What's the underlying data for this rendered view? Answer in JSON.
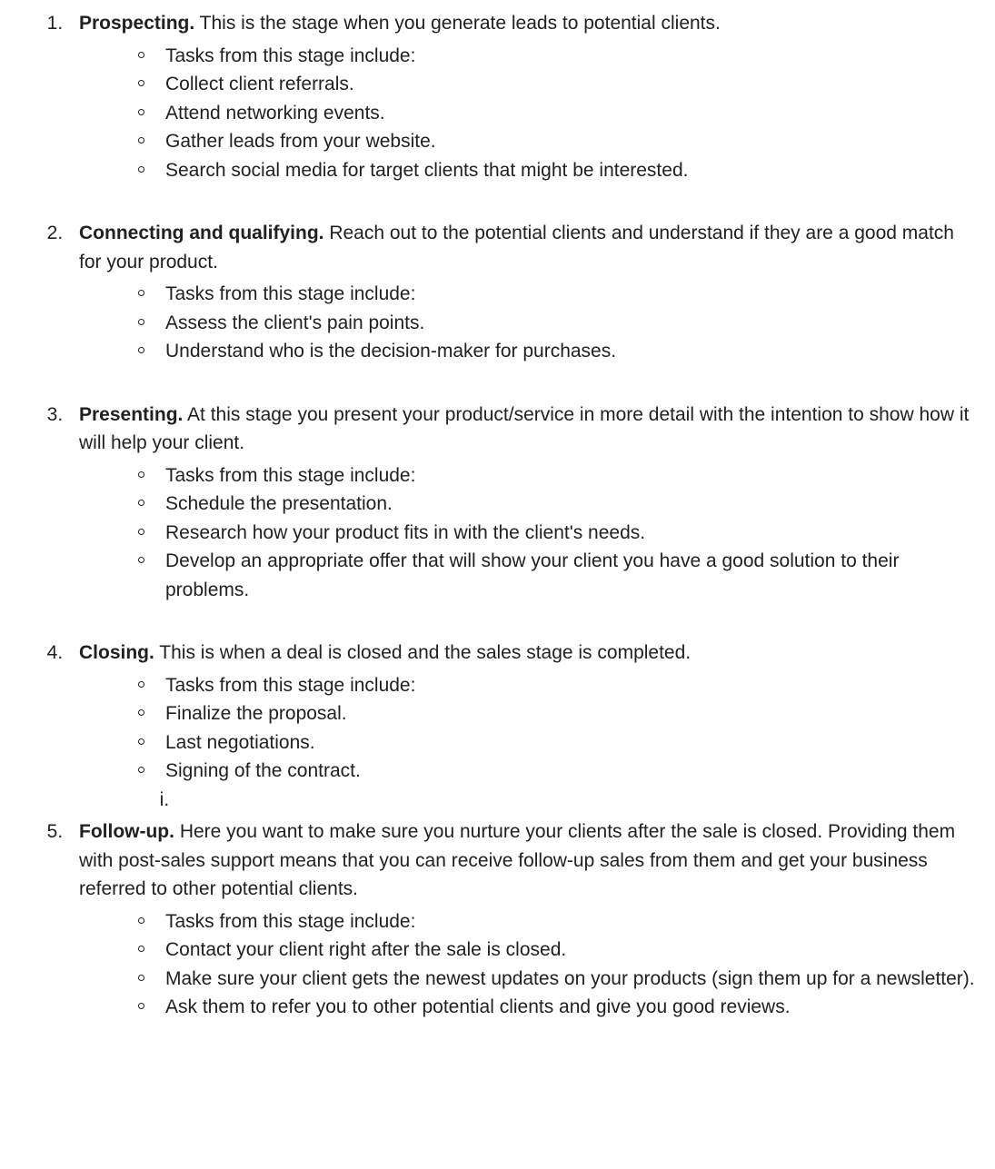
{
  "stages": [
    {
      "title": "Prospecting.",
      "description": " This is the stage when you generate leads to potential clients.",
      "tasks": [
        "Tasks from this stage include:",
        "Collect client referrals.",
        "Attend networking events.",
        "Gather leads from your website.",
        "Search social media for target clients that might be interested."
      ]
    },
    {
      "title": "Connecting and qualifying.",
      "description": " Reach out to the potential clients and understand if they are a good match for your product.",
      "tasks": [
        "Tasks from this stage include:",
        "Assess the client's pain points.",
        "Understand who is the decision-maker for purchases."
      ]
    },
    {
      "title": "Presenting.",
      "description": " At this stage you present your product/service in more detail with the intention to show how it will help your client.",
      "tasks": [
        "Tasks from this stage include:",
        "Schedule the presentation.",
        "Research how your product fits in with the client's needs.",
        "Develop an appropriate offer that will show your client you have a good solution to their problems."
      ]
    },
    {
      "title": "Closing.",
      "description": " This is when a deal is closed and the sales stage is completed.",
      "tasks": [
        "Tasks from this stage include:",
        "Finalize the proposal.",
        "Last negotiations.",
        "Signing of the contract."
      ],
      "roman": [
        ""
      ]
    },
    {
      "title": "Follow-up.",
      "description": " Here you want to make sure you nurture your clients after the sale is closed. Providing them with post-sales support means that you can receive follow-up sales from them and get your business referred to other potential clients.",
      "tasks": [
        "Tasks from this stage include:",
        "Contact your client right after the sale is closed.",
        "Make sure your client gets the newest updates on your products (sign them up for a newsletter).",
        "Ask them to refer you to other potential clients and give you good reviews."
      ]
    }
  ]
}
